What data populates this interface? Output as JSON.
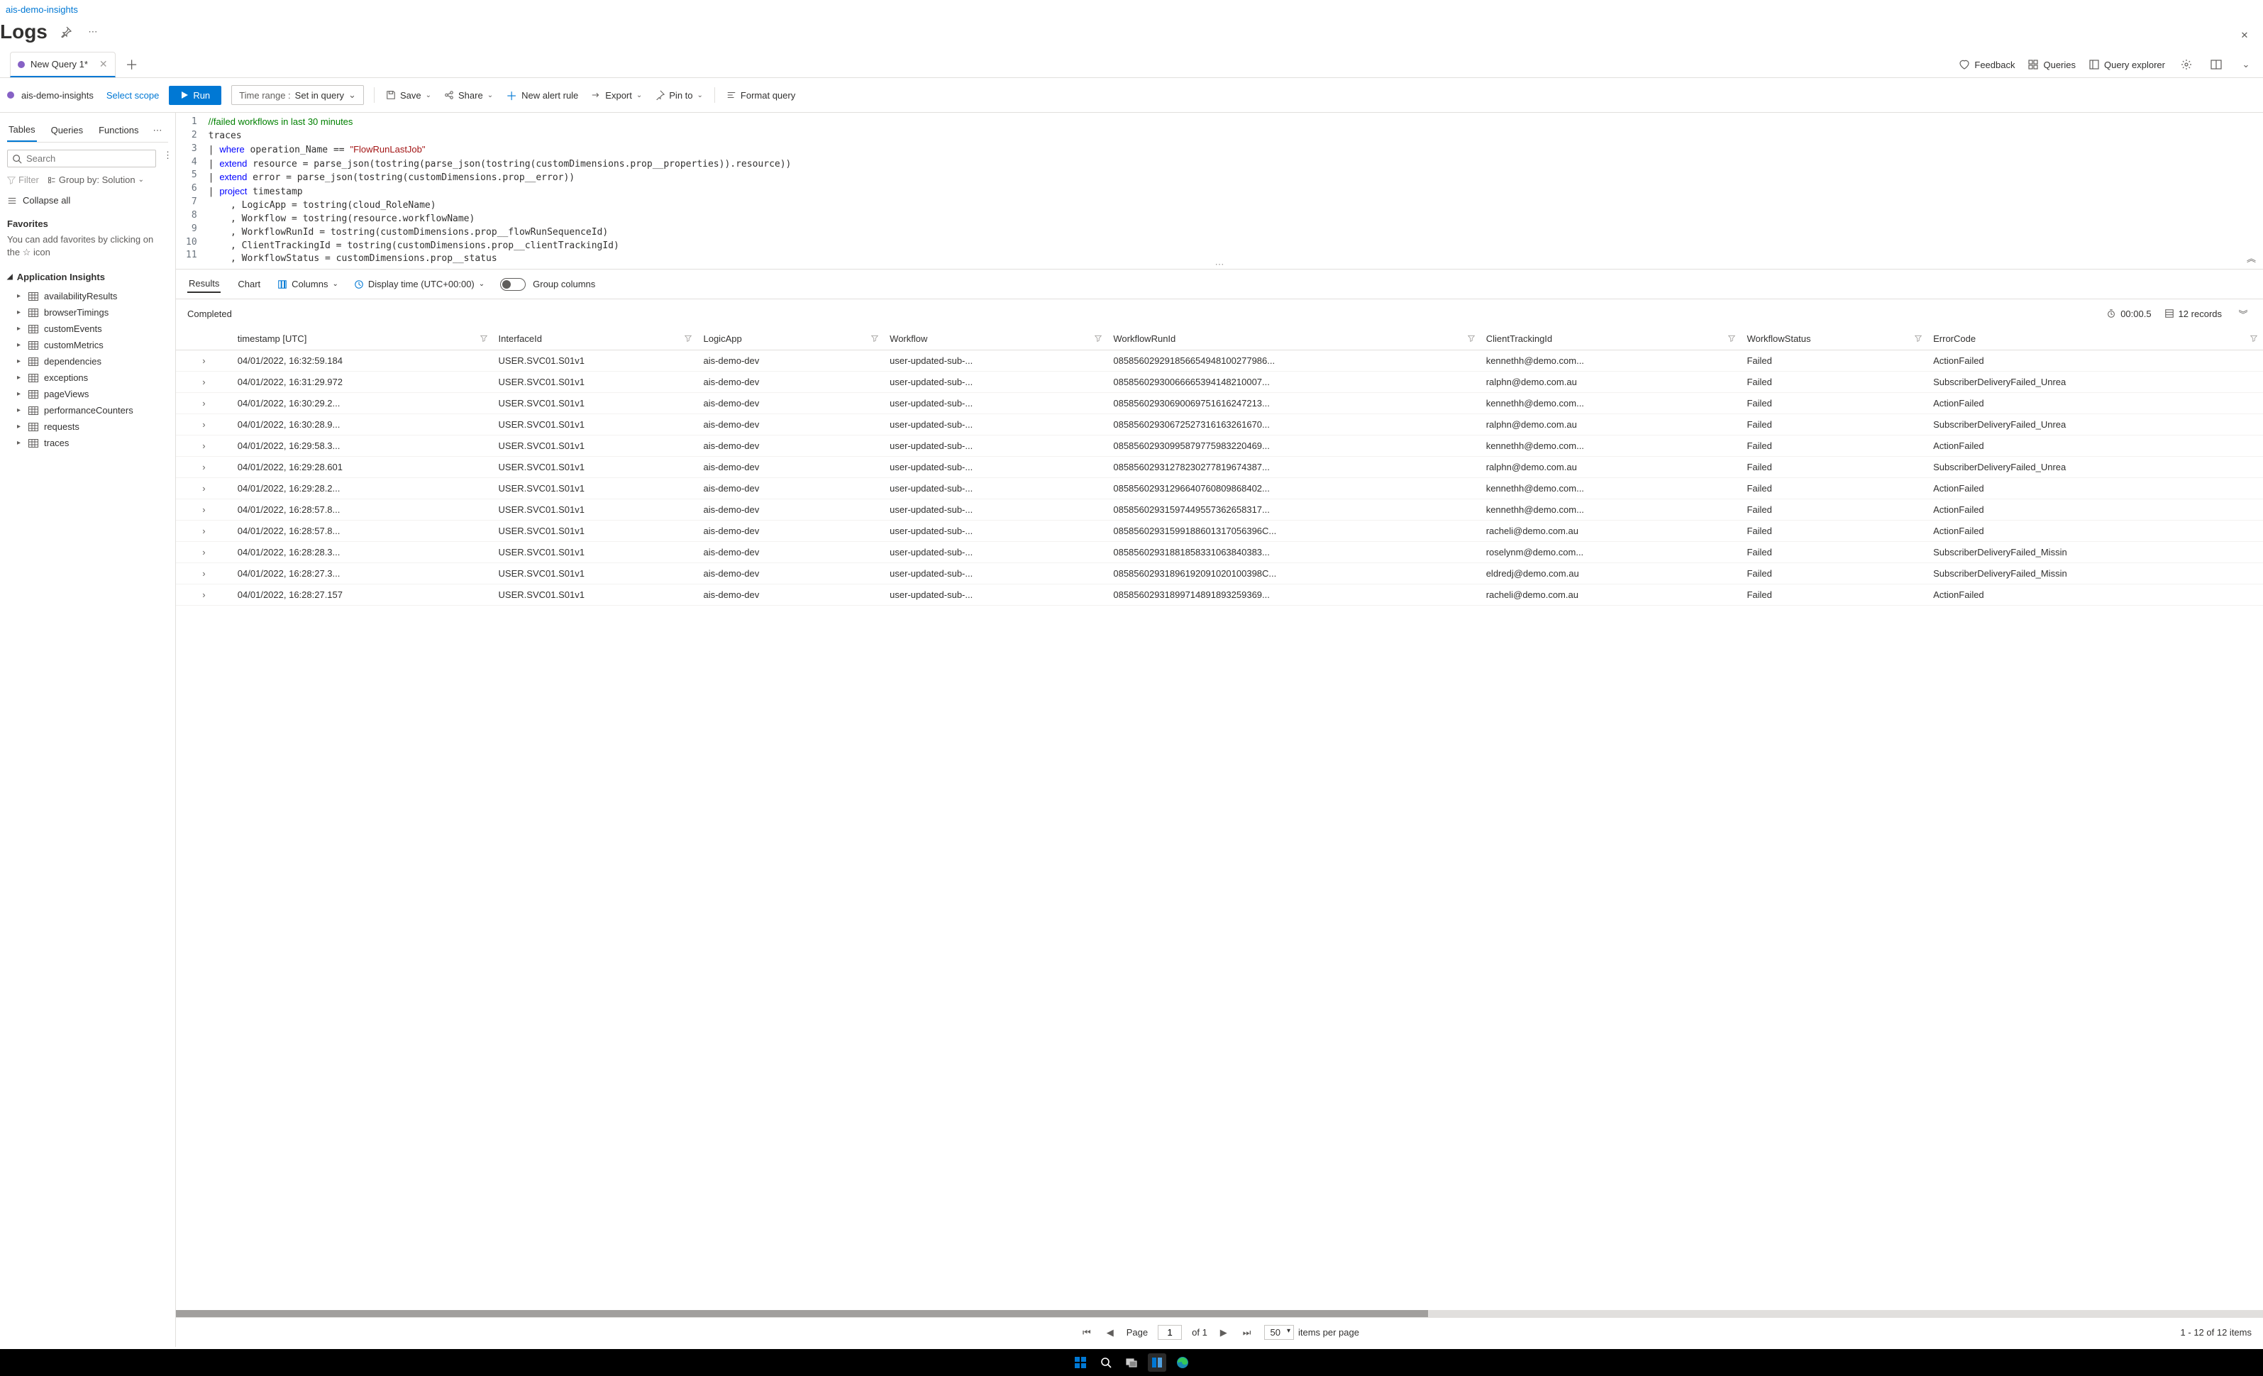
{
  "breadcrumb": "ais-demo-insights",
  "page_title": "Logs",
  "tabs": {
    "query_tab": "New Query 1*",
    "feedback": "Feedback",
    "queries": "Queries",
    "explorer": "Query explorer"
  },
  "toolbar": {
    "scope_name": "ais-demo-insights",
    "select_scope": "Select scope",
    "run": "Run",
    "time_label": "Time range :",
    "time_value": "Set in query",
    "save": "Save",
    "share": "Share",
    "new_alert": "New alert rule",
    "export": "Export",
    "pin": "Pin to",
    "format": "Format query"
  },
  "sidebar": {
    "tabs": [
      "Tables",
      "Queries",
      "Functions"
    ],
    "search_ph": "Search",
    "filter": "Filter",
    "group_by": "Group by: Solution",
    "collapse_all": "Collapse all",
    "favorites": "Favorites",
    "fav_desc": "You can add favorites by clicking on the ☆ icon",
    "tree_head": "Application Insights",
    "items": [
      "availabilityResults",
      "browserTimings",
      "customEvents",
      "customMetrics",
      "dependencies",
      "exceptions",
      "pageViews",
      "performanceCounters",
      "requests",
      "traces"
    ]
  },
  "editor": {
    "lines": [
      {
        "n": 1,
        "seg": [
          [
            "//failed workflows in last 30 minutes",
            "c-comment"
          ]
        ]
      },
      {
        "n": 2,
        "seg": [
          [
            "traces",
            ""
          ]
        ]
      },
      {
        "n": 3,
        "seg": [
          [
            "| ",
            ""
          ],
          [
            "where",
            "c-key"
          ],
          [
            " operation_Name == ",
            ""
          ],
          [
            "\"FlowRunLastJob\"",
            "c-str"
          ]
        ]
      },
      {
        "n": 4,
        "seg": [
          [
            "| ",
            ""
          ],
          [
            "extend",
            "c-key"
          ],
          [
            " resource = parse_json(tostring(parse_json(tostring(customDimensions.prop__properties)).resource))",
            ""
          ]
        ]
      },
      {
        "n": 5,
        "seg": [
          [
            "| ",
            ""
          ],
          [
            "extend",
            "c-key"
          ],
          [
            " error = parse_json(tostring(customDimensions.prop__error))",
            ""
          ]
        ]
      },
      {
        "n": 6,
        "seg": [
          [
            "| ",
            ""
          ],
          [
            "project",
            "c-key"
          ],
          [
            " timestamp",
            ""
          ]
        ]
      },
      {
        "n": 7,
        "seg": [
          [
            "    , LogicApp = tostring(cloud_RoleName)",
            ""
          ]
        ]
      },
      {
        "n": 8,
        "seg": [
          [
            "    , Workflow = tostring(resource.workflowName)",
            ""
          ]
        ]
      },
      {
        "n": 9,
        "seg": [
          [
            "    , WorkflowRunId = tostring(customDimensions.prop__flowRunSequenceId)",
            ""
          ]
        ]
      },
      {
        "n": 10,
        "seg": [
          [
            "    , ClientTrackingId = tostring(customDimensions.prop__clientTrackingId)",
            ""
          ]
        ]
      },
      {
        "n": 11,
        "seg": [
          [
            "    , WorkflowStatus = customDimensions.prop__status",
            ""
          ]
        ]
      }
    ]
  },
  "results": {
    "tab_results": "Results",
    "tab_chart": "Chart",
    "columns_btn": "Columns",
    "display_time": "Display time (UTC+00:00)",
    "group_columns": "Group columns",
    "completed": "Completed",
    "elapsed": "00:00.5",
    "record_count": "12 records",
    "headers": [
      "timestamp [UTC]",
      "InterfaceId",
      "LogicApp",
      "Workflow",
      "WorkflowRunId",
      "ClientTrackingId",
      "WorkflowStatus",
      "ErrorCode"
    ],
    "rows": [
      [
        "04/01/2022, 16:32:59.184",
        "USER.SVC01.S01v1",
        "ais-demo-dev",
        "user-updated-sub-...",
        "085856029291856654948100277986...",
        "kennethh@demo.com...",
        "Failed",
        "ActionFailed"
      ],
      [
        "04/01/2022, 16:31:29.972",
        "USER.SVC01.S01v1",
        "ais-demo-dev",
        "user-updated-sub-...",
        "08585602930066665394148210007...",
        "ralphn@demo.com.au",
        "Failed",
        "SubscriberDeliveryFailed_Unrea"
      ],
      [
        "04/01/2022, 16:30:29.2...",
        "USER.SVC01.S01v1",
        "ais-demo-dev",
        "user-updated-sub-...",
        "08585602930690069751616247213...",
        "kennethh@demo.com...",
        "Failed",
        "ActionFailed"
      ],
      [
        "04/01/2022, 16:30:28.9...",
        "USER.SVC01.S01v1",
        "ais-demo-dev",
        "user-updated-sub-...",
        "08585602930672527316163261670...",
        "ralphn@demo.com.au",
        "Failed",
        "SubscriberDeliveryFailed_Unrea"
      ],
      [
        "04/01/2022, 16:29:58.3...",
        "USER.SVC01.S01v1",
        "ais-demo-dev",
        "user-updated-sub-...",
        "08585602930995879775983220469...",
        "kennethh@demo.com...",
        "Failed",
        "ActionFailed"
      ],
      [
        "04/01/2022, 16:29:28.601",
        "USER.SVC01.S01v1",
        "ais-demo-dev",
        "user-updated-sub-...",
        "08585602931278230277819674387...",
        "ralphn@demo.com.au",
        "Failed",
        "SubscriberDeliveryFailed_Unrea"
      ],
      [
        "04/01/2022, 16:29:28.2...",
        "USER.SVC01.S01v1",
        "ais-demo-dev",
        "user-updated-sub-...",
        "08585602931296640760809868402...",
        "kennethh@demo.com...",
        "Failed",
        "ActionFailed"
      ],
      [
        "04/01/2022, 16:28:57.8...",
        "USER.SVC01.S01v1",
        "ais-demo-dev",
        "user-updated-sub-...",
        "08585602931597449557362658317...",
        "kennethh@demo.com...",
        "Failed",
        "ActionFailed"
      ],
      [
        "04/01/2022, 16:28:57.8...",
        "USER.SVC01.S01v1",
        "ais-demo-dev",
        "user-updated-sub-...",
        "08585602931599188601317056396C...",
        "racheli@demo.com.au",
        "Failed",
        "ActionFailed"
      ],
      [
        "04/01/2022, 16:28:28.3...",
        "USER.SVC01.S01v1",
        "ais-demo-dev",
        "user-updated-sub-...",
        "08585602931881858331063840383...",
        "roselynm@demo.com...",
        "Failed",
        "SubscriberDeliveryFailed_Missin"
      ],
      [
        "04/01/2022, 16:28:27.3...",
        "USER.SVC01.S01v1",
        "ais-demo-dev",
        "user-updated-sub-...",
        "08585602931896192091020100398C...",
        "eldredj@demo.com.au",
        "Failed",
        "SubscriberDeliveryFailed_Missin"
      ],
      [
        "04/01/2022, 16:28:27.157",
        "USER.SVC01.S01v1",
        "ais-demo-dev",
        "user-updated-sub-...",
        "08585602931899714891893259369...",
        "racheli@demo.com.au",
        "Failed",
        "ActionFailed"
      ]
    ]
  },
  "pager": {
    "page_label": "Page",
    "page_value": "1",
    "of": "of 1",
    "ipp_value": "50",
    "ipp_label": "items per page",
    "summary": "1 - 12 of 12 items"
  }
}
